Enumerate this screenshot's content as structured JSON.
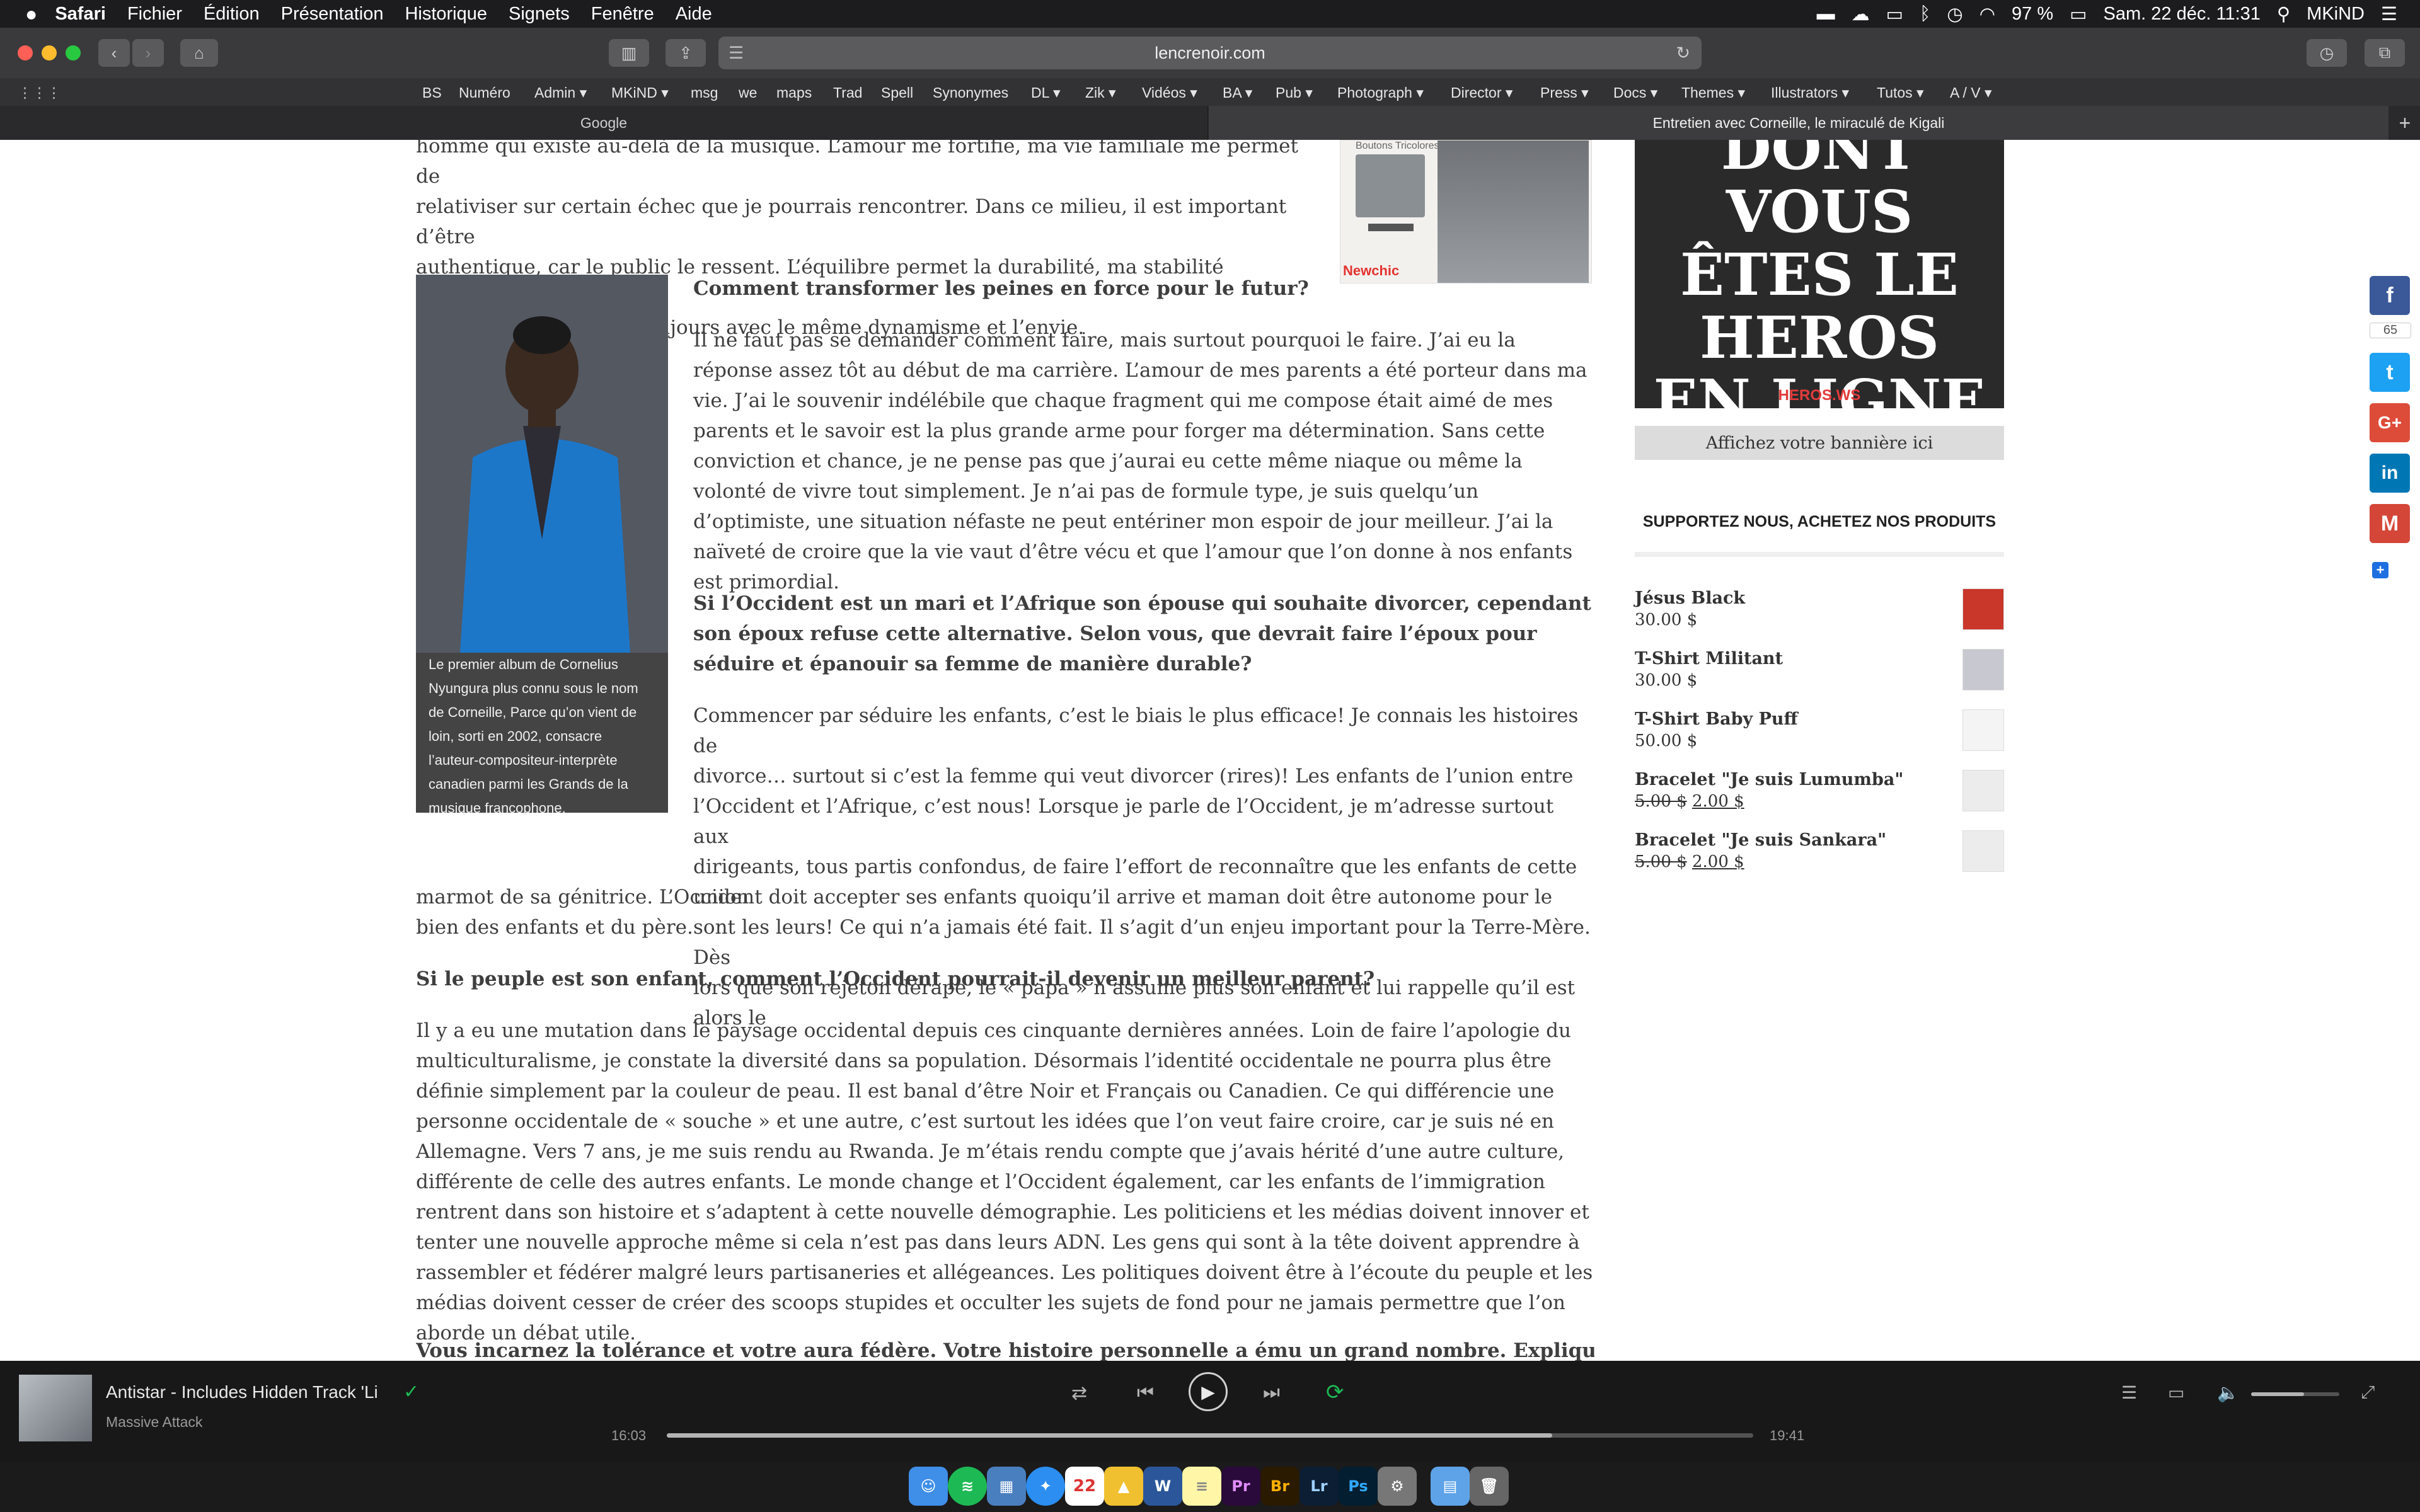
{
  "menubar": {
    "app": "Safari",
    "menus": [
      "Fichier",
      "Édition",
      "Présentation",
      "Historique",
      "Signets",
      "Fenêtre",
      "Aide"
    ],
    "battery": "97 %",
    "datetime": "Sam. 22 déc.  11:31",
    "user": "MKiND"
  },
  "browser": {
    "address": "lencrenoir.com",
    "bookmarks": [
      "BS",
      "Numéro",
      "Admin",
      "MKiND",
      "msg",
      "we",
      "maps",
      "Trad",
      "Spell",
      "Synonymes",
      "DL",
      "Zik",
      "Vidéos",
      "BA",
      "Pub",
      "Photograph",
      "Director",
      "Press",
      "Docs",
      "Themes",
      "Illustrators",
      "Tutos",
      "A / V"
    ],
    "tabs": [
      "Google",
      "Entretien avec Corneille, le miraculé de Kigali"
    ]
  },
  "article": {
    "top_paragraph_lines": [
      "homme qui existe au-delà de la musique. L’amour me fortifie, ma vie familiale me permet de",
      "relativiser sur certain échec que je pourrais rencontrer. Dans ce milieu, il est important d’être",
      "authentique, car le public le ressent. L’équilibre permet la durabilité, ma stabilité personnelle",
      "me permet de revenir toujours avec le même dynamisme et l’envie."
    ],
    "photo_caption": " Le premier album de Cornelius Nyungura plus connu sous le nom de Corneille, Parce qu’on vient de loin, sorti en 2002, consacre l’auteur-compositeur-interprète canadien parmi les Grands de la musique francophone.",
    "q1": "Comment transformer les peines en force pour le futur?",
    "a1": "Il ne faut pas se demander comment faire, mais surtout pourquoi le faire. J’ai eu la réponse assez tôt au début de ma carrière. L’amour de mes parents a été porteur dans ma vie. J’ai le souvenir indélébile que chaque fragment qui me compose était aimé de mes parents et le savoir est la plus grande arme pour forger ma détermination. Sans cette conviction et chance, je ne pense pas que j’aurai eu cette même niaque ou même la volonté de vivre tout simplement.  Je n’ai pas de formule type, je suis quelqu’un d’optimiste, une situation néfaste ne peut entériner mon espoir de jour meilleur. J’ai la naïveté de croire que la vie vaut d’être vécu et que l’amour que l’on donne à nos enfants est primordial.",
    "q2": "Si l’Occident est un mari et l’Afrique son épouse qui souhaite divorcer, cependant son époux refuse cette alternative. Selon vous, que devrait faire l’époux pour séduire et épanouir sa femme de manière durable?",
    "a2_lines": [
      "Commencer par séduire les enfants, c’est le biais le plus efficace! Je connais les histoires de",
      "divorce… surtout si c’est la femme qui veut divorcer (rires)! Les enfants de l’union entre",
      "l’Occident et l’Afrique, c’est nous! Lorsque je parle de l’Occident, je m’adresse surtout aux",
      "dirigeants, tous partis confondus, de faire l’effort de reconnaître que les enfants de cette union",
      "sont les leurs! Ce qui n’a jamais été fait. Il s’agit d’un enjeu important pour la Terre-Mère. Dès",
      "lors que son rejeton dérape, le « papa » n’assume plus son enfant et lui rappelle qu’il est alors le"
    ],
    "a2_tail": "marmot de sa génitrice. L’Occident doit accepter ses enfants quoiqu’il arrive et maman doit être autonome pour le bien des enfants et du père.",
    "q3": "Si le peuple est son enfant, comment l’Occident pourrait-il devenir un meilleur parent?",
    "a3": "Il y a eu une mutation dans le paysage occidental depuis ces cinquante dernières années. Loin de faire l’apologie du multiculturalisme, je constate la diversité dans sa population. Désormais l’identité occidentale ne pourra plus être définie simplement par la couleur de peau. Il est banal d’être Noir et Français ou Canadien. Ce qui différencie une personne occidentale de « souche » et une autre, c’est surtout les idées que l’on veut faire croire, car je suis né en Allemagne. Vers 7 ans, je me suis rendu au Rwanda. Je m’étais rendu compte que j’avais hérité d’une autre culture, différente de celle des autres enfants. Le monde change et l’Occident également, car les enfants de l’immigration rentrent dans son histoire et s’adaptent à cette nouvelle démographie. Les politiciens et les médias doivent innover et tenter une nouvelle approche même si cela n’est pas dans leurs ADN. Les gens qui sont à la tête doivent apprendre à rassembler et fédérer malgré leurs partisaneries et allégeances. Les politiques doivent être à l’écoute du peuple et les médias doivent cesser de créer des scoops stupides et occulter les sujets de fond pour ne jamais permettre que l’on aborde un débat utile.",
    "q4_partial": "Vous incarnez la tolérance et votre aura fédère. Votre histoire personnelle a ému un grand nombre. Expliquez-nous quelles"
  },
  "ad": {
    "small_text": "Boutons Tricolores",
    "brand": "Newchic"
  },
  "sidebar": {
    "banner_lines": [
      "DONT VOUS",
      "ÊTES LE",
      "HEROS",
      "EN LIGNE"
    ],
    "banner_site": "HEROS.WS",
    "banner_cta": "Affichez votre bannière ici",
    "shop_title": "SUPPORTEZ NOUS, ACHETEZ NOS PRODUITS",
    "products": [
      {
        "name": "Jésus Black",
        "price": "30.00 $",
        "old": "",
        "thumb": "#c9362a"
      },
      {
        "name": "T-Shirt Militant",
        "price": "30.00 $",
        "old": "",
        "thumb": "#c8c8d0"
      },
      {
        "name": "T-Shirt Baby Puff",
        "price": "50.00 $",
        "old": "",
        "thumb": "#f4f4f4"
      },
      {
        "name": "Bracelet \"Je suis Lumumba\"",
        "price": "2.00 $",
        "old": "5.00 $",
        "thumb": "#ececec"
      },
      {
        "name": "Bracelet \"Je suis Sankara\"",
        "price": "2.00 $",
        "old": "5.00 $",
        "thumb": "#ececec"
      }
    ]
  },
  "share": {
    "count": "65"
  },
  "player": {
    "track": "Antistar - Includes Hidden Track 'Li",
    "artist": "Massive Attack",
    "elapsed": "16:03",
    "total": "19:41",
    "progress": 0.815,
    "volume": 0.6
  },
  "dock": {
    "calendar_day": "22"
  },
  "colors": {
    "facebook": "#3b5998",
    "twitter": "#1da1f2",
    "googleplus": "#dd4b39",
    "linkedin": "#0077b5",
    "gmail": "#d44638",
    "spotify": "#1db954"
  }
}
